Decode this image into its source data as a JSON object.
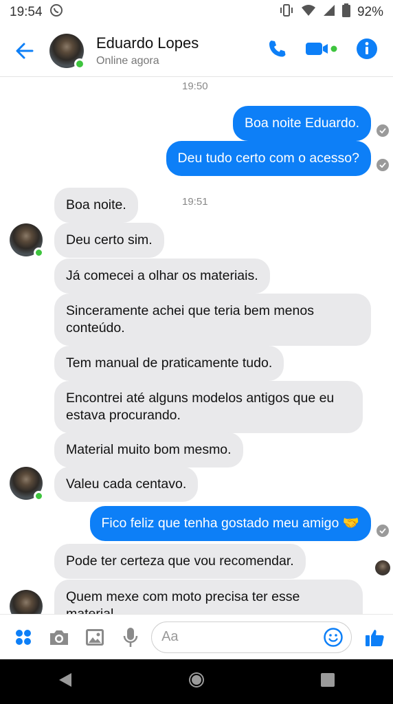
{
  "status_bar": {
    "time": "19:54",
    "battery": "92%"
  },
  "header": {
    "contact_name": "Eduardo Lopes",
    "presence": "Online agora"
  },
  "timestamps": [
    "19:50",
    "19:51"
  ],
  "messages": [
    {
      "dir": "out",
      "text": "Boa noite Eduardo."
    },
    {
      "dir": "out",
      "text": "Deu tudo certo com o acesso?"
    },
    {
      "dir": "in",
      "text": "Boa noite."
    },
    {
      "dir": "in",
      "text": "Deu certo sim."
    },
    {
      "dir": "in",
      "text": "Já comecei a olhar os materiais."
    },
    {
      "dir": "in",
      "text": "Sinceramente achei que teria bem menos conteúdo."
    },
    {
      "dir": "in",
      "text": "Tem manual de praticamente tudo."
    },
    {
      "dir": "in",
      "text": "Encontrei até alguns modelos antigos que eu estava procurando."
    },
    {
      "dir": "in",
      "text": "Material muito bom mesmo."
    },
    {
      "dir": "in",
      "text": "Valeu cada centavo."
    },
    {
      "dir": "out",
      "text": "Fico feliz que tenha gostado meu amigo 🤝"
    },
    {
      "dir": "in",
      "text": "Pode ter certeza que vou recomendar."
    },
    {
      "dir": "in",
      "text": "Quem mexe com moto precisa ter esse material."
    }
  ],
  "composer": {
    "placeholder": "Aa"
  },
  "colors": {
    "accent": "#0d7ff7",
    "incoming_bubble": "#e9e9eb",
    "online": "#3ec43e"
  },
  "icons": [
    "back-arrow-icon",
    "phone-icon",
    "video-icon",
    "info-icon",
    "apps-icon",
    "camera-icon",
    "gallery-icon",
    "mic-icon",
    "emoji-icon",
    "like-icon",
    "nav-back-icon",
    "nav-home-icon",
    "nav-recents-icon",
    "whatsapp-icon",
    "vibrate-icon",
    "wifi-icon",
    "signal-icon",
    "battery-icon"
  ]
}
